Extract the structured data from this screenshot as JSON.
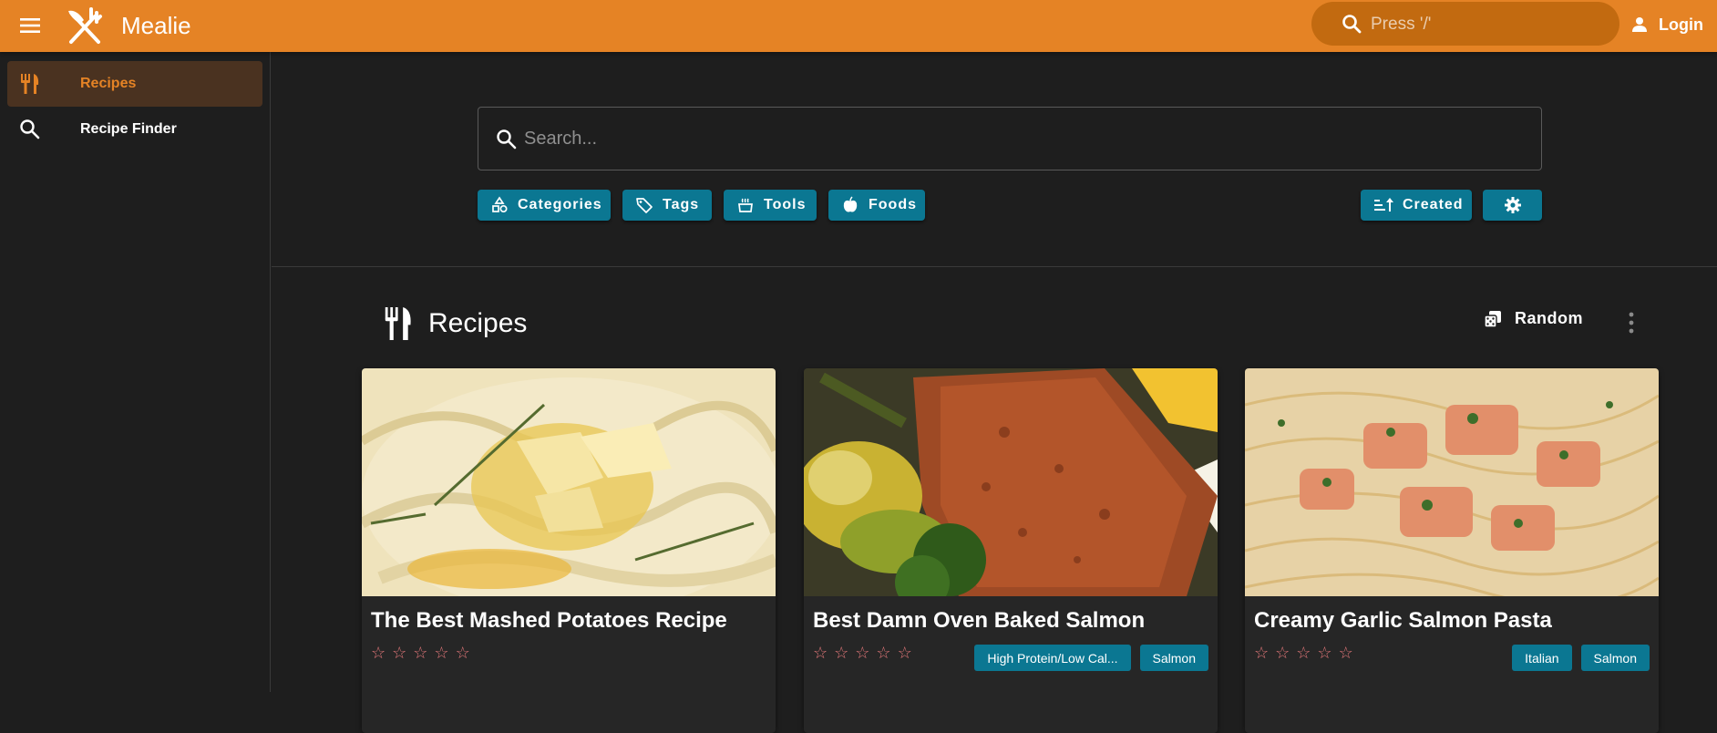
{
  "app": {
    "title": "Mealie"
  },
  "header": {
    "search_placeholder": "Press '/'",
    "login_label": "Login"
  },
  "sidebar": {
    "items": [
      {
        "label": "Recipes",
        "icon": "fork-knife-icon",
        "active": true
      },
      {
        "label": "Recipe Finder",
        "icon": "search-icon",
        "active": false
      }
    ]
  },
  "filters": {
    "search_placeholder": "Search...",
    "buttons": [
      {
        "label": "Categories",
        "icon": "shapes-icon"
      },
      {
        "label": "Tags",
        "icon": "tag-icon"
      },
      {
        "label": "Tools",
        "icon": "pot-icon"
      },
      {
        "label": "Foods",
        "icon": "apple-icon"
      }
    ],
    "sort_label": "Created"
  },
  "section": {
    "title": "Recipes",
    "random_label": "Random"
  },
  "colors": {
    "primary": "#E58325",
    "accent": "#0B7792",
    "star": "#E4787A",
    "background": "#1e1e1e"
  },
  "recipes": [
    {
      "title": "The Best Mashed Potatoes Recipe",
      "rating": 0,
      "tags": []
    },
    {
      "title": "Best Damn Oven Baked Salmon",
      "rating": 0,
      "tags": [
        "High Protein/Low Cal...",
        "Salmon"
      ]
    },
    {
      "title": "Creamy Garlic Salmon Pasta",
      "rating": 0,
      "tags": [
        "Italian",
        "Salmon"
      ]
    }
  ]
}
